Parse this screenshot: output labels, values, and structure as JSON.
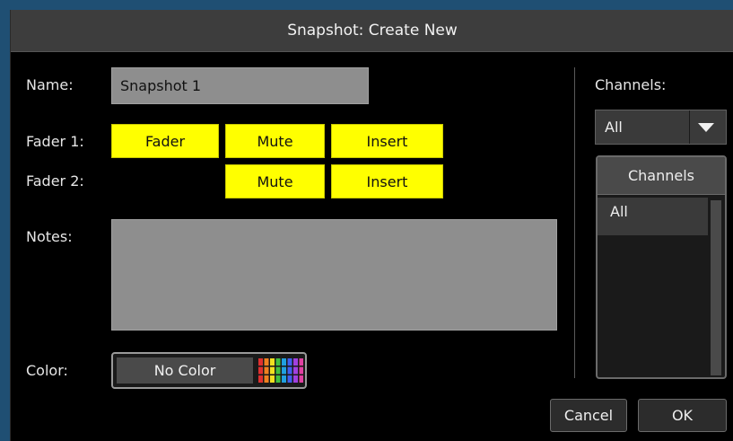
{
  "dialog": {
    "title": "Snapshot: Create New"
  },
  "form": {
    "name_label": "Name:",
    "name_value": "Snapshot 1",
    "fader1_label": "Fader 1:",
    "fader2_label": "Fader 2:",
    "fader1_buttons": {
      "fader": "Fader",
      "mute": "Mute",
      "insert": "Insert"
    },
    "fader2_buttons": {
      "mute": "Mute",
      "insert": "Insert"
    },
    "notes_label": "Notes:",
    "notes_value": "",
    "color_label": "Color:",
    "color_value": "No Color"
  },
  "channels": {
    "label": "Channels:",
    "filter_value": "All",
    "list_header": "Channels",
    "items": [
      "All"
    ]
  },
  "actions": {
    "cancel": "Cancel",
    "ok": "OK"
  },
  "colors": {
    "accent_button": "#ffff00",
    "field_bg": "#8e8e8e",
    "dialog_bg": "#000000",
    "titlebar_bg": "#3d3d3d",
    "palette": [
      "#e03030",
      "#f08020",
      "#f0e020",
      "#40c040",
      "#20a0e0",
      "#4060f0",
      "#a040e0",
      "#e040a0"
    ]
  }
}
